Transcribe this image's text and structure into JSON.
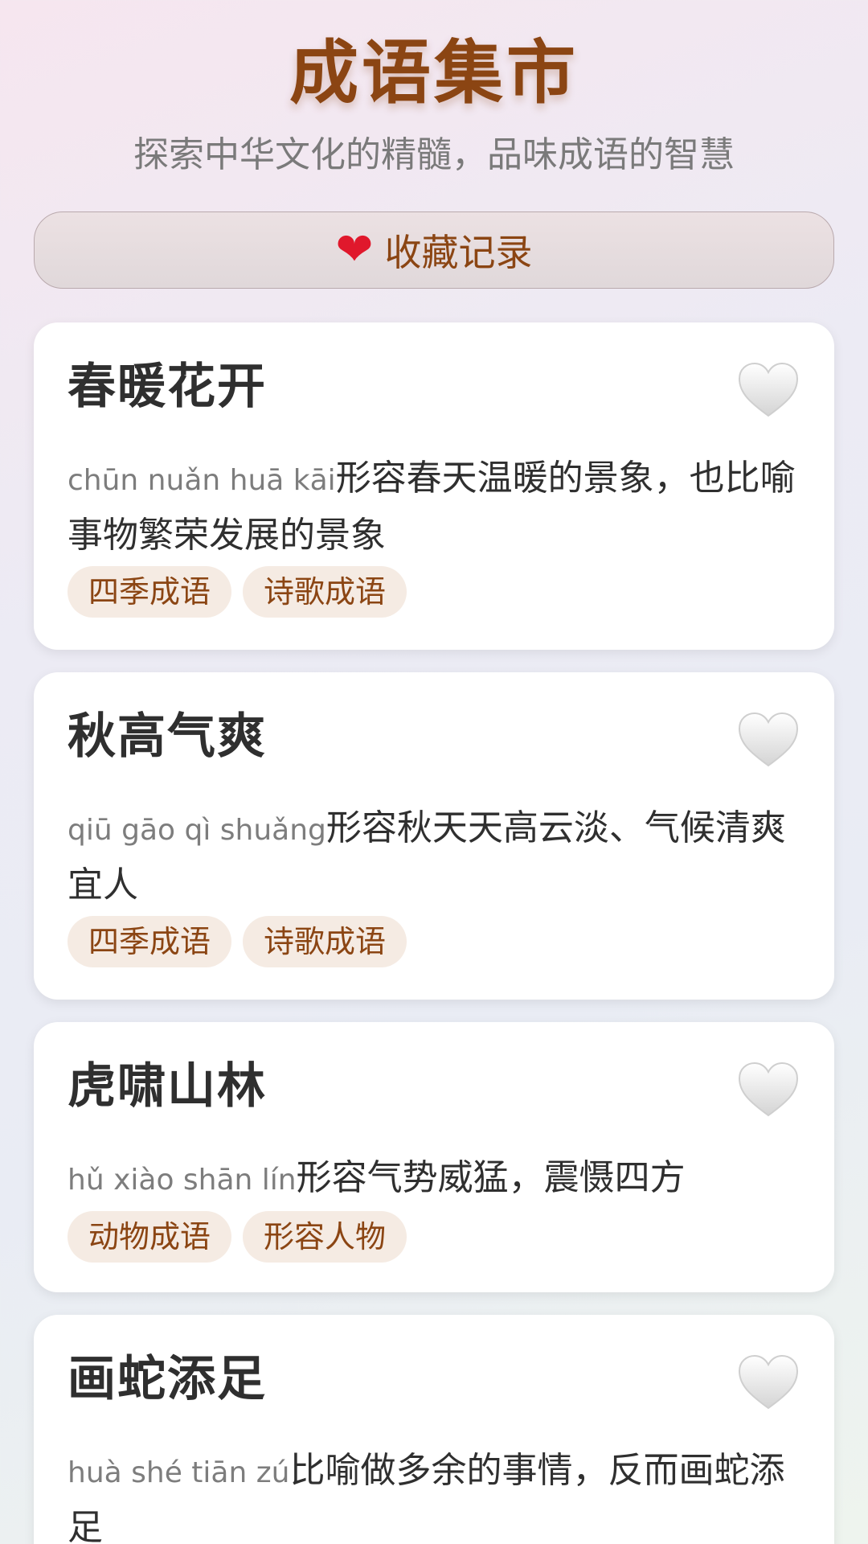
{
  "header": {
    "title": "成语集市",
    "subtitle": "探索中华文化的精髓，品味成语的智慧"
  },
  "favorites_button": {
    "icon": "red-heart-icon",
    "label": "收藏记录"
  },
  "colors": {
    "brand": "#8b4513",
    "tag_bg": "#f5ebe3",
    "heart_red": "#e0182c"
  },
  "idioms": [
    {
      "title": "春暖花开",
      "pinyin": "chūn nuǎn huā kāi",
      "meaning": "形容春天温暖的景象，也比喻事物繁荣发展的景象",
      "tags": [
        "四季成语",
        "诗歌成语"
      ],
      "favorite_icon": "white-heart-icon"
    },
    {
      "title": "秋高气爽",
      "pinyin": "qiū gāo qì shuǎng",
      "meaning": "形容秋天天高云淡、气候清爽宜人",
      "tags": [
        "四季成语",
        "诗歌成语"
      ],
      "favorite_icon": "white-heart-icon"
    },
    {
      "title": "虎啸山林",
      "pinyin": "hǔ xiào shān lín",
      "meaning": "形容气势威猛，震慑四方",
      "tags": [
        "动物成语",
        "形容人物"
      ],
      "favorite_icon": "white-heart-icon"
    },
    {
      "title": "画蛇添足",
      "pinyin": "huà shé tiān zú",
      "meaning": "比喻做多余的事情，反而画蛇添足",
      "tags": [],
      "favorite_icon": "white-heart-icon"
    }
  ]
}
